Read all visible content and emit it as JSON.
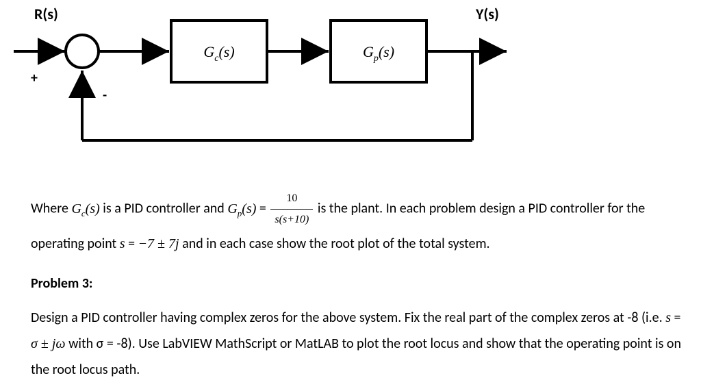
{
  "signals": {
    "input": "R(s)",
    "output": "Y(s)",
    "plus": "+",
    "minus": "-"
  },
  "blocks": {
    "controller": {
      "base": "G",
      "sub": "c",
      "arg": "(s)"
    },
    "plant": {
      "base": "G",
      "sub": "p",
      "arg": "(s)"
    }
  },
  "paragraph1": {
    "pre": "Where ",
    "gc_base": "G",
    "gc_sub": "c",
    "gc_arg": "(s)",
    "mid1": " is a PID controller and ",
    "gp_base": "G",
    "gp_sub": "p",
    "gp_arg": "(s)",
    "eq": " = ",
    "frac_num": "10",
    "frac_den": "s(s+10)",
    "mid2": " is the plant.  In each problem design a PID controller for the operating point ",
    "s_var": "s",
    "s_eq": " = ",
    "s_val": "−7 ± 7j",
    "tail": " and in each case show the root plot of the total system."
  },
  "heading": "Problem 3:",
  "paragraph2": {
    "t1": "Design a PID controller having complex zeros for the above system.  Fix the real part of the complex zeros at -8 (i.e. ",
    "s_var": "s",
    "eq1": " = ",
    "sigma": "σ",
    "pm": " ± ",
    "j": "j",
    "omega": "ω",
    "with": " with σ = -8).  Use LabVIEW MathScript or MatLAB to plot the root locus and show that the operating point is on the root locus path."
  },
  "chart_data": {
    "type": "block-diagram",
    "topology": "unity-negative-feedback",
    "input": "R(s)",
    "output": "Y(s)",
    "forward_path": [
      "summing_junction",
      "G_c(s)",
      "G_p(s)"
    ],
    "feedback": {
      "from": "Y(s)",
      "to": "summing_junction",
      "gain": 1,
      "sign": "-"
    },
    "plant_transfer_function": {
      "numerator": "10",
      "denominator": "s(s+10)"
    },
    "controller_type": "PID",
    "operating_point": {
      "real": -7,
      "imag_plus_minus": 7
    },
    "pid_zero_real_part": -8
  }
}
